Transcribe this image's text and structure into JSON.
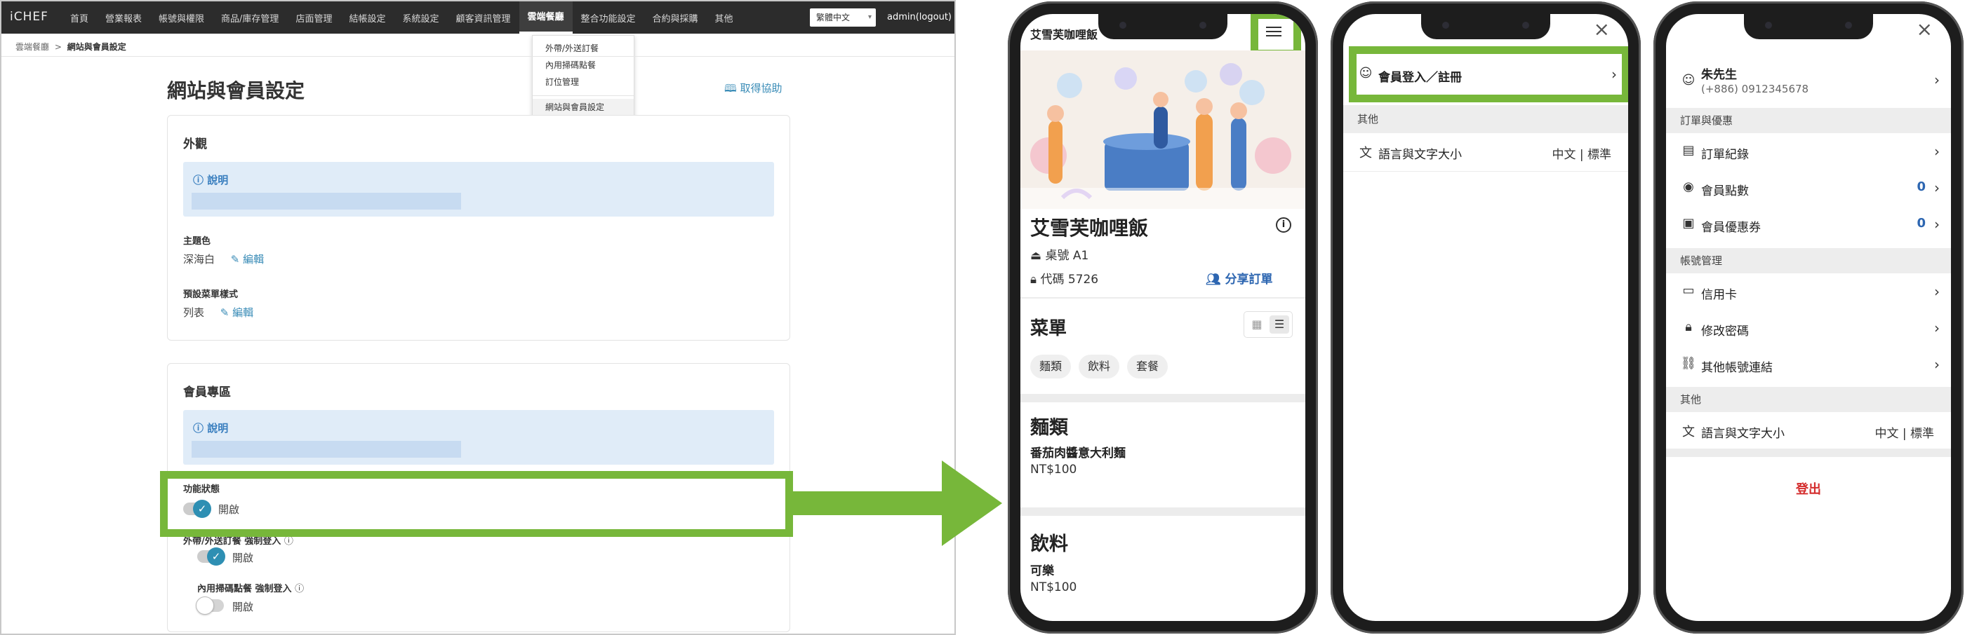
{
  "admin": {
    "logo": "iCHEF",
    "nav": [
      "首頁",
      "營業報表",
      "帳號與權限",
      "商品/庫存管理",
      "店面管理",
      "結帳設定",
      "系統設定",
      "顧客資訊管理",
      "雲端餐廳",
      "整合功能設定",
      "合約與採購",
      "其他"
    ],
    "active_nav": "雲端餐廳",
    "language": "繁體中文",
    "user_link": "admin(logout)",
    "dropdown": [
      "外帶/外送訂餐",
      "內用掃碼點餐",
      "訂位管理",
      "網站與會員設定"
    ],
    "breadcrumb": {
      "parent": "雲端餐廳",
      "sep": ">",
      "current": "網站與會員設定"
    },
    "page_title": "網站與會員設定",
    "help_link": "取得協助",
    "appearance": {
      "title": "外觀",
      "note_label": "說明",
      "theme_label": "主題色",
      "theme_value": "深海白",
      "menu_style_label": "預設菜單樣式",
      "menu_style_value": "列表",
      "edit": "編輯"
    },
    "member": {
      "title": "會員專區",
      "note_label": "說明",
      "status_label": "功能狀態",
      "status_value": "開啟",
      "takeout_label": "外帶/外送訂餐 強制登入",
      "takeout_value": "開啟",
      "dinein_label": "內用掃碼點餐 強制登入",
      "dinein_value": "開啟",
      "status_on": true,
      "takeout_on": true,
      "dinein_on": false
    }
  },
  "phone1": {
    "header": "艾雪芙咖哩飯",
    "restaurant": "艾雪芙咖哩飯",
    "table": "桌號 A1",
    "code": "代碼 5726",
    "share": "分享訂單",
    "menu_title": "菜單",
    "chips": [
      "麵類",
      "飲料",
      "套餐"
    ],
    "sections": [
      {
        "title": "麵類",
        "dish": "番茄肉醬意大利麵",
        "price": "NT$100"
      },
      {
        "title": "飲料",
        "dish": "可樂",
        "price": "NT$100"
      }
    ]
  },
  "phone2": {
    "login": "會員登入／註冊",
    "other_header": "其他",
    "lang_label": "語言與文字大小",
    "lang_value": "中文 | 標準"
  },
  "phone3": {
    "name": "朱先生",
    "phone": "(+886) 0912345678",
    "orders_header": "訂單與優惠",
    "order_history": "訂單紀錄",
    "points": "會員點數",
    "points_value": "0",
    "coupons": "會員優惠券",
    "coupons_value": "0",
    "account_header": "帳號管理",
    "credit_card": "信用卡",
    "change_password": "修改密碼",
    "linked_accounts": "其他帳號連結",
    "other_header": "其他",
    "lang_label": "語言與文字大小",
    "lang_value": "中文 | 標準",
    "logout": "登出"
  },
  "colors": {
    "highlight": "#77b73a",
    "link": "#2d66b1",
    "toggle": "#2e8fb3",
    "logout": "#d42d2d"
  },
  "icons": [
    "menu-icon",
    "close-icon",
    "info-icon",
    "tray-icon",
    "lock-icon",
    "add-user-icon",
    "grid-view-icon",
    "list-view-icon",
    "user-circle-icon",
    "translate-icon",
    "receipt-icon",
    "coins-icon",
    "ticket-icon",
    "credit-card-icon",
    "link-icon",
    "pencil-icon",
    "book-icon",
    "chevron-right-icon"
  ]
}
